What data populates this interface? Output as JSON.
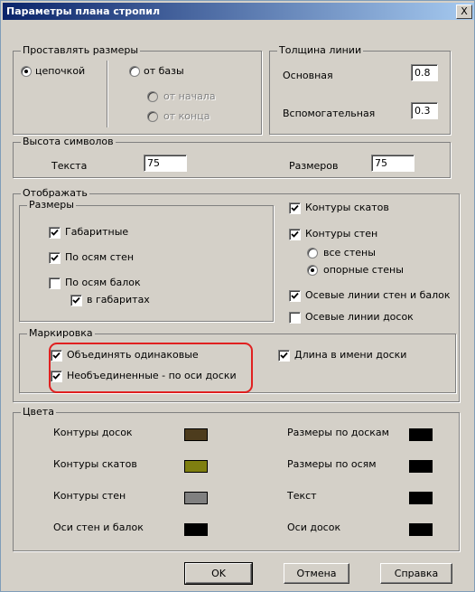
{
  "window": {
    "title": "Параметры плана стропил",
    "close_label": "X"
  },
  "dimensions": {
    "title": "Проставлять размеры",
    "chain_label": "цепочкой",
    "from_base_label": "от базы",
    "from_start_label": "от начала",
    "from_end_label": "от конца",
    "selected": "цепочкой"
  },
  "line_thickness": {
    "title": "Толщина линии",
    "main_label": "Основная",
    "main_value": "0.8",
    "aux_label": "Вспомогательная",
    "aux_value": "0.3"
  },
  "symbol_height": {
    "title": "Высота символов",
    "text_label": "Текста",
    "text_value": "75",
    "dims_label": "Размеров",
    "dims_value": "75"
  },
  "display": {
    "title": "Отображать",
    "sizes": {
      "title": "Размеры",
      "overall": {
        "label": "Габаритные",
        "checked": true
      },
      "wall_axes": {
        "label": "По осям стен",
        "checked": true
      },
      "beam_axes": {
        "label": "По осям балок",
        "checked": false
      },
      "in_overall": {
        "label": "в габаритах",
        "checked": true
      }
    },
    "slope_contours": {
      "label": "Контуры скатов",
      "checked": true
    },
    "wall_contours": {
      "label": "Контуры стен",
      "checked": true
    },
    "all_walls_label": "все стены",
    "support_walls_label": "опорные стены",
    "walls_selected": "опорные стены",
    "axial_walls_beams": {
      "label": "Осевые линии стен и балок",
      "checked": true
    },
    "axial_boards": {
      "label": "Осевые линии досок",
      "checked": false
    },
    "marking": {
      "title": "Маркировка",
      "merge_same": {
        "label": "Объединять одинаковые",
        "checked": true
      },
      "unmerged_axis": {
        "label": "Необъединенные - по оси доски",
        "checked": true
      },
      "length_in_name": {
        "label": "Длина в имени доски",
        "checked": true
      }
    }
  },
  "colors": {
    "title": "Цвета",
    "items": [
      {
        "label": "Контуры досок",
        "color": "#4d3c1d"
      },
      {
        "label": "Контуры скатов",
        "color": "#7f7f10"
      },
      {
        "label": "Контуры стен",
        "color": "#808080"
      },
      {
        "label": "Оси стен и балок",
        "color": "#000000"
      },
      {
        "label": "Размеры по доскам",
        "color": "#000000"
      },
      {
        "label": "Размеры по осям",
        "color": "#000000"
      },
      {
        "label": "Текст",
        "color": "#000000"
      },
      {
        "label": "Оси досок",
        "color": "#000000"
      }
    ]
  },
  "buttons": {
    "ok": "OK",
    "cancel": "Отмена",
    "help": "Справка"
  },
  "highlight_color": "#e02020"
}
